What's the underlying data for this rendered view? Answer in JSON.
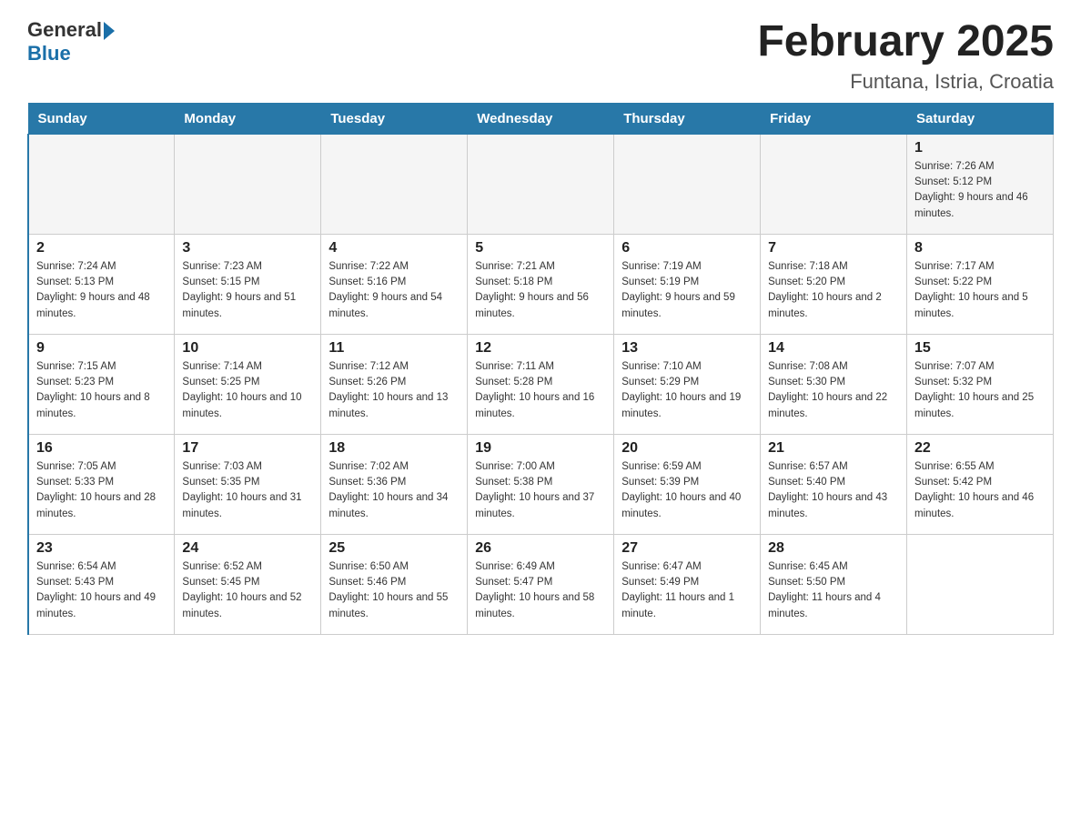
{
  "header": {
    "logo_general": "General",
    "logo_blue": "Blue",
    "title": "February 2025",
    "subtitle": "Funtana, Istria, Croatia"
  },
  "days_of_week": [
    "Sunday",
    "Monday",
    "Tuesday",
    "Wednesday",
    "Thursday",
    "Friday",
    "Saturday"
  ],
  "weeks": [
    [
      {
        "day": "",
        "info": ""
      },
      {
        "day": "",
        "info": ""
      },
      {
        "day": "",
        "info": ""
      },
      {
        "day": "",
        "info": ""
      },
      {
        "day": "",
        "info": ""
      },
      {
        "day": "",
        "info": ""
      },
      {
        "day": "1",
        "info": "Sunrise: 7:26 AM\nSunset: 5:12 PM\nDaylight: 9 hours and 46 minutes."
      }
    ],
    [
      {
        "day": "2",
        "info": "Sunrise: 7:24 AM\nSunset: 5:13 PM\nDaylight: 9 hours and 48 minutes."
      },
      {
        "day": "3",
        "info": "Sunrise: 7:23 AM\nSunset: 5:15 PM\nDaylight: 9 hours and 51 minutes."
      },
      {
        "day": "4",
        "info": "Sunrise: 7:22 AM\nSunset: 5:16 PM\nDaylight: 9 hours and 54 minutes."
      },
      {
        "day": "5",
        "info": "Sunrise: 7:21 AM\nSunset: 5:18 PM\nDaylight: 9 hours and 56 minutes."
      },
      {
        "day": "6",
        "info": "Sunrise: 7:19 AM\nSunset: 5:19 PM\nDaylight: 9 hours and 59 minutes."
      },
      {
        "day": "7",
        "info": "Sunrise: 7:18 AM\nSunset: 5:20 PM\nDaylight: 10 hours and 2 minutes."
      },
      {
        "day": "8",
        "info": "Sunrise: 7:17 AM\nSunset: 5:22 PM\nDaylight: 10 hours and 5 minutes."
      }
    ],
    [
      {
        "day": "9",
        "info": "Sunrise: 7:15 AM\nSunset: 5:23 PM\nDaylight: 10 hours and 8 minutes."
      },
      {
        "day": "10",
        "info": "Sunrise: 7:14 AM\nSunset: 5:25 PM\nDaylight: 10 hours and 10 minutes."
      },
      {
        "day": "11",
        "info": "Sunrise: 7:12 AM\nSunset: 5:26 PM\nDaylight: 10 hours and 13 minutes."
      },
      {
        "day": "12",
        "info": "Sunrise: 7:11 AM\nSunset: 5:28 PM\nDaylight: 10 hours and 16 minutes."
      },
      {
        "day": "13",
        "info": "Sunrise: 7:10 AM\nSunset: 5:29 PM\nDaylight: 10 hours and 19 minutes."
      },
      {
        "day": "14",
        "info": "Sunrise: 7:08 AM\nSunset: 5:30 PM\nDaylight: 10 hours and 22 minutes."
      },
      {
        "day": "15",
        "info": "Sunrise: 7:07 AM\nSunset: 5:32 PM\nDaylight: 10 hours and 25 minutes."
      }
    ],
    [
      {
        "day": "16",
        "info": "Sunrise: 7:05 AM\nSunset: 5:33 PM\nDaylight: 10 hours and 28 minutes."
      },
      {
        "day": "17",
        "info": "Sunrise: 7:03 AM\nSunset: 5:35 PM\nDaylight: 10 hours and 31 minutes."
      },
      {
        "day": "18",
        "info": "Sunrise: 7:02 AM\nSunset: 5:36 PM\nDaylight: 10 hours and 34 minutes."
      },
      {
        "day": "19",
        "info": "Sunrise: 7:00 AM\nSunset: 5:38 PM\nDaylight: 10 hours and 37 minutes."
      },
      {
        "day": "20",
        "info": "Sunrise: 6:59 AM\nSunset: 5:39 PM\nDaylight: 10 hours and 40 minutes."
      },
      {
        "day": "21",
        "info": "Sunrise: 6:57 AM\nSunset: 5:40 PM\nDaylight: 10 hours and 43 minutes."
      },
      {
        "day": "22",
        "info": "Sunrise: 6:55 AM\nSunset: 5:42 PM\nDaylight: 10 hours and 46 minutes."
      }
    ],
    [
      {
        "day": "23",
        "info": "Sunrise: 6:54 AM\nSunset: 5:43 PM\nDaylight: 10 hours and 49 minutes."
      },
      {
        "day": "24",
        "info": "Sunrise: 6:52 AM\nSunset: 5:45 PM\nDaylight: 10 hours and 52 minutes."
      },
      {
        "day": "25",
        "info": "Sunrise: 6:50 AM\nSunset: 5:46 PM\nDaylight: 10 hours and 55 minutes."
      },
      {
        "day": "26",
        "info": "Sunrise: 6:49 AM\nSunset: 5:47 PM\nDaylight: 10 hours and 58 minutes."
      },
      {
        "day": "27",
        "info": "Sunrise: 6:47 AM\nSunset: 5:49 PM\nDaylight: 11 hours and 1 minute."
      },
      {
        "day": "28",
        "info": "Sunrise: 6:45 AM\nSunset: 5:50 PM\nDaylight: 11 hours and 4 minutes."
      },
      {
        "day": "",
        "info": ""
      }
    ]
  ]
}
